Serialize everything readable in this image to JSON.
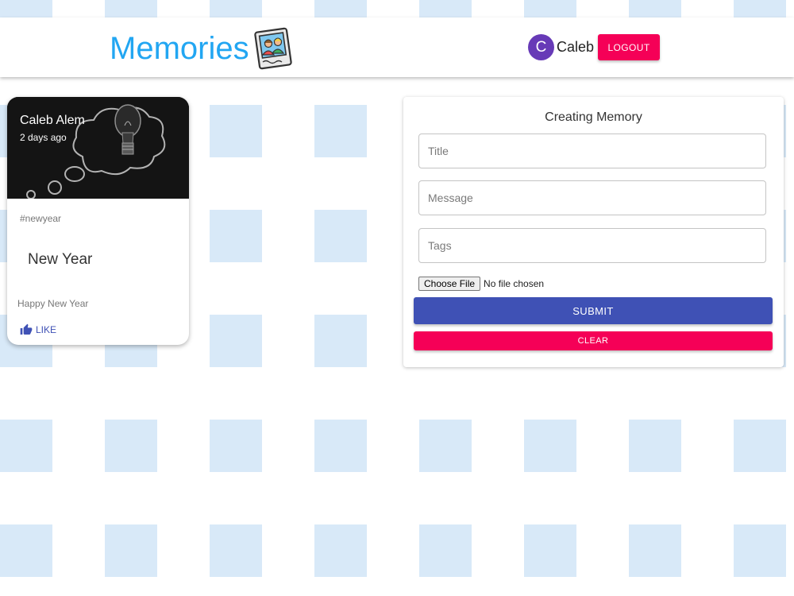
{
  "header": {
    "title": "Memories",
    "logo_icon": "family-photo-icon",
    "user": {
      "avatar_initial": "C",
      "name": "Caleb",
      "logout_label": "LOGOUT",
      "avatar_color": "#673ab7"
    }
  },
  "posts": [
    {
      "author": "Caleb Alem",
      "time": "2 days ago",
      "tags": "#newyear",
      "title": "New Year",
      "message": "Happy New Year",
      "like_label": "LIKE",
      "media_icon": "lightbulb-thought-cloud-image"
    }
  ],
  "form": {
    "heading": "Creating Memory",
    "title_placeholder": "Title",
    "message_placeholder": "Message",
    "tags_placeholder": "Tags",
    "file_button_label": "Choose File",
    "file_status": "No file chosen",
    "submit_label": "SUBMIT",
    "clear_label": "CLEAR"
  },
  "colors": {
    "brand": "#22a6f2",
    "primary": "#3f51b5",
    "secondary": "#f50057",
    "background_pattern": "#d8e9f8"
  }
}
